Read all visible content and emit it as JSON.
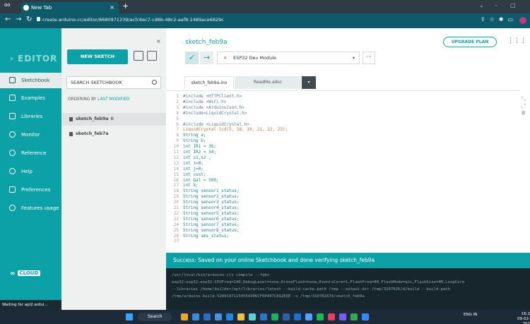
{
  "browser": {
    "menu_label": "oo",
    "tab_title": "New Tab",
    "url": "create.arduino.cc/editor/8680971239/acfc6ec7-cd6b-48c2-aaf8-1489ace6829c",
    "new_tab_symbol": "+",
    "close_symbol": "×"
  },
  "leftnav": {
    "brand": "EDITOR",
    "items": [
      {
        "label": "Sketchbook"
      },
      {
        "label": "Examples"
      },
      {
        "label": "Libraries"
      },
      {
        "label": "Monitor"
      },
      {
        "label": "Reference"
      },
      {
        "label": "Help"
      },
      {
        "label": "Preferences"
      },
      {
        "label": "Features usage"
      }
    ],
    "cloud": "CLOUD",
    "status": "Waiting for api2.ardui..."
  },
  "panel": {
    "new_sketch": "NEW SKETCH",
    "search_placeholder": "SEARCH SKETCHBOOK",
    "ordering_label": "ORDERING BY",
    "ordering_value": "LAST MODIFIED",
    "sketches": [
      {
        "name": "sketch_feb9a"
      },
      {
        "name": "sketch_feb7a"
      }
    ]
  },
  "editor": {
    "title": "sketch_feb9a",
    "upgrade": "UPGRADE PLAN",
    "board": "ESP32 Dev Module",
    "tabs": [
      {
        "label": "sketch_feb9a.ino"
      },
      {
        "label": "ReadMe.adoc"
      }
    ],
    "code": [
      "#include <HTTPClient.h>",
      "#include <WiFi.h>",
      "#include <ArduinoJson.h>",
      "#include<LiquidCrystal.h>",
      "",
      "#include <LiquidCrystal.h>",
      "LiquidCrystal lcd(5, 18, 19, 21, 22, 23);",
      "String a;",
      "String b;",
      "int IR1 = 36;",
      "int IR2 = 34;",
      "int s1,s2 ;",
      "int i=0;",
      "int j=0;",
      "int cost;",
      "int bal = 500;",
      "int k;",
      "String sensor1_status;",
      "String sensor2_status;",
      "String sensor3_status;",
      "String sensor4_status;",
      "String sensor5_status;",
      "String sensor6_status;",
      "String sensor7_status;",
      "String sensor8_status;",
      "String sms_status;",
      ""
    ],
    "success": "Success: Saved on your online Sketchbook and done verifying sketch_feb9a",
    "console": [
      "/usr/local/bin/arduino-cli compile --fqbn",
      "esp32:esp32:esp32:CPUFreq=240,DebugLevel=none,EraseFlash=none,EventsCore=1,FlashFreq=80,FlashMode=qio,FlashSize=4M,LoopCore",
      "--libraries /home/builder/opt/libraries/latest --build-cache-path /tmp --output-dir /tmp/3107026/d/build --build-path",
      "/tmp/arduino-build-5280C871154554396CF00497C892E5E -v /tmp/310702674/sketch_feb9a"
    ]
  },
  "taskbar": {
    "search": "Search",
    "lang": "ENG IN",
    "time": "16:1",
    "date": "09-02-202"
  },
  "colors": {
    "teal": "#0ca1a6",
    "chrome": "#0f5a6a"
  }
}
